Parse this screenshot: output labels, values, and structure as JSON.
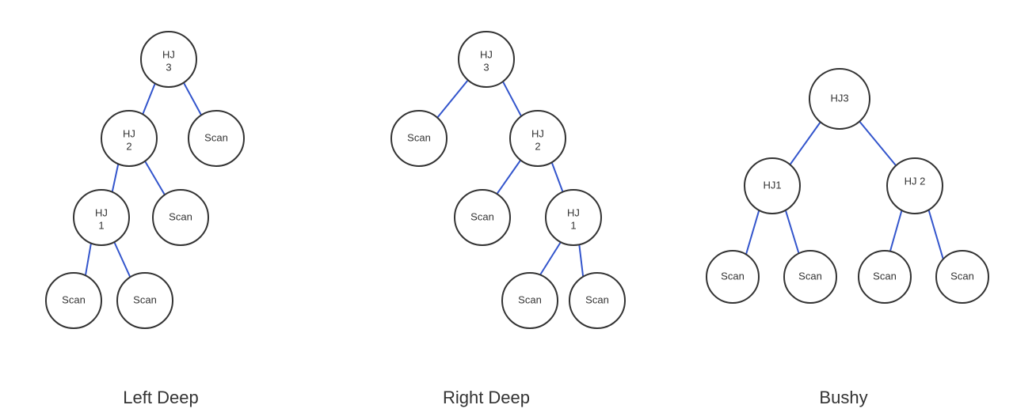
{
  "trees": [
    {
      "name": "left-deep",
      "label": "Left Deep"
    },
    {
      "name": "right-deep",
      "label": "Right Deep"
    },
    {
      "name": "bushy",
      "label": "Bushy"
    }
  ]
}
